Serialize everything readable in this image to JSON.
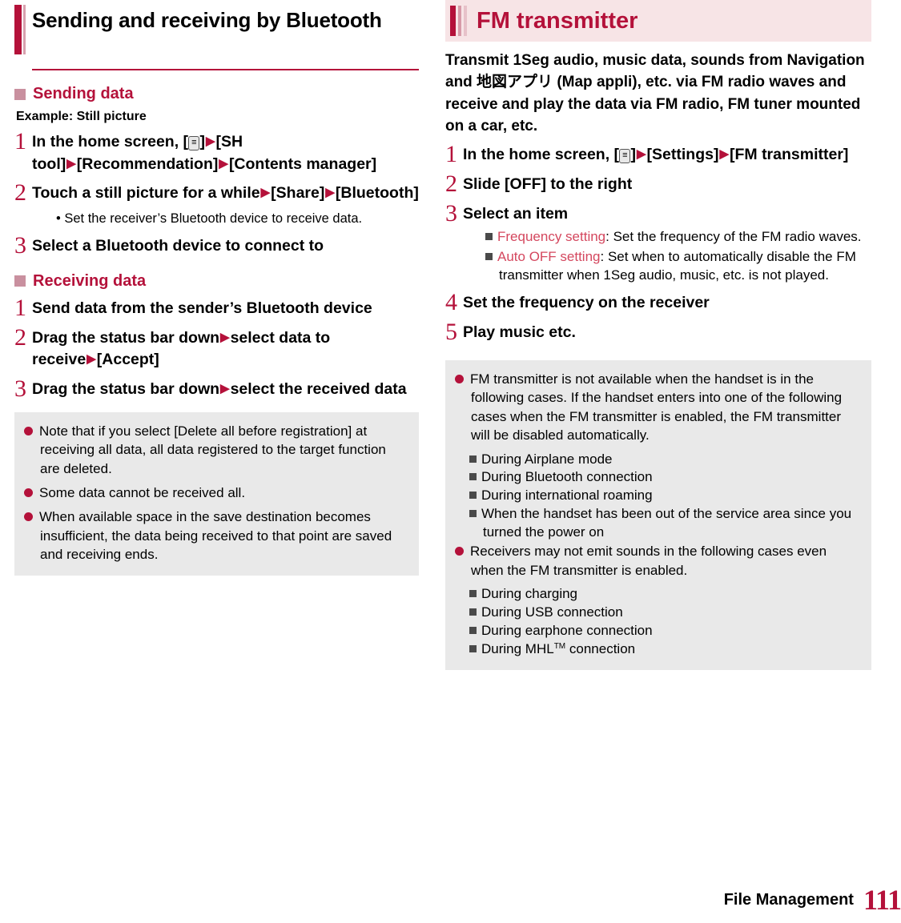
{
  "left": {
    "chapter_title": "Sending and receiving by Bluetooth",
    "section1": {
      "heading": "Sending data",
      "example": "Example: Still picture",
      "steps": [
        {
          "num": "1",
          "parts": [
            {
              "t": "text",
              "v": "In the home screen, ["
            },
            {
              "t": "key",
              "v": "MENU"
            },
            {
              "t": "text",
              "v": "]"
            },
            {
              "t": "arrow"
            },
            {
              "t": "text",
              "v": "[SH tool]"
            },
            {
              "t": "arrow"
            },
            {
              "t": "text",
              "v": "[Recommendation]"
            },
            {
              "t": "arrow"
            },
            {
              "t": "text",
              "v": "[Contents manager]"
            }
          ]
        },
        {
          "num": "2",
          "parts": [
            {
              "t": "text",
              "v": "Touch a still picture for a while"
            },
            {
              "t": "arrow"
            },
            {
              "t": "text",
              "v": "[Share]"
            },
            {
              "t": "arrow"
            },
            {
              "t": "text",
              "v": "[Bluetooth]"
            }
          ],
          "bullets": [
            "Set the receiver’s Bluetooth device to receive data."
          ]
        },
        {
          "num": "3",
          "parts": [
            {
              "t": "text",
              "v": "Select a Bluetooth device to connect to"
            }
          ]
        }
      ]
    },
    "section2": {
      "heading": "Receiving data",
      "steps": [
        {
          "num": "1",
          "parts": [
            {
              "t": "text",
              "v": "Send data from the sender’s Bluetooth device"
            }
          ]
        },
        {
          "num": "2",
          "parts": [
            {
              "t": "text",
              "v": "Drag the status bar down"
            },
            {
              "t": "arrow"
            },
            {
              "t": "text",
              "v": "select data to receive"
            },
            {
              "t": "arrow"
            },
            {
              "t": "text",
              "v": "[Accept]"
            }
          ]
        },
        {
          "num": "3",
          "parts": [
            {
              "t": "text",
              "v": "Drag the status bar down"
            },
            {
              "t": "arrow"
            },
            {
              "t": "text",
              "v": "select the received data"
            }
          ]
        }
      ]
    },
    "notes": [
      {
        "text": "Note that if you select [Delete all before registration] at receiving all data, all data registered to the target function are deleted.",
        "subs": []
      },
      {
        "text": "Some data cannot be received all.",
        "subs": []
      },
      {
        "text": "When available space in the save destination becomes insufficient, the data being received to that point are saved and receiving ends.",
        "subs": []
      }
    ]
  },
  "right": {
    "banner_title": "FM transmitter",
    "intro": "Transmit 1Seg audio, music data, sounds from Navigation and 地図アプリ (Map appli), etc. via FM radio waves and receive and play the data via FM radio, FM tuner mounted on a car, etc.",
    "steps": [
      {
        "num": "1",
        "parts": [
          {
            "t": "text",
            "v": "In the home screen, ["
          },
          {
            "t": "key",
            "v": "MENU"
          },
          {
            "t": "text",
            "v": "]"
          },
          {
            "t": "arrow"
          },
          {
            "t": "text",
            "v": "[Settings]"
          },
          {
            "t": "arrow"
          },
          {
            "t": "text",
            "v": "[FM transmitter]"
          }
        ]
      },
      {
        "num": "2",
        "parts": [
          {
            "t": "text",
            "v": "Slide [OFF] to the right"
          }
        ]
      },
      {
        "num": "3",
        "parts": [
          {
            "t": "text",
            "v": "Select an item"
          }
        ],
        "subitems": [
          {
            "term": "Frequency setting",
            "rest": ": Set the frequency of the FM radio waves."
          },
          {
            "term": "Auto OFF setting",
            "rest": ": Set when to automatically disable the FM transmitter when 1Seg audio, music, etc. is not played."
          }
        ]
      },
      {
        "num": "4",
        "parts": [
          {
            "t": "text",
            "v": "Set the frequency on the receiver"
          }
        ]
      },
      {
        "num": "5",
        "parts": [
          {
            "t": "text",
            "v": "Play music etc."
          }
        ]
      }
    ],
    "notes": [
      {
        "text": "FM transmitter is not available when the handset is in the following cases. If the handset enters into one of the following cases when the FM transmitter is enabled, the FM transmitter will be disabled automatically.",
        "subs": [
          "During Airplane mode",
          "During Bluetooth connection",
          "During international roaming",
          "When the handset has been out of the service area since you turned the power on"
        ]
      },
      {
        "text": "Receivers may not emit sounds in the following cases even when the FM transmitter is enabled.",
        "subs": [
          "During charging",
          "During USB connection",
          "During earphone connection",
          "During MHL™ connection"
        ]
      }
    ]
  },
  "footer": {
    "label": "File Management",
    "page": "111"
  },
  "colors": {
    "accent": "#b4113a",
    "banner_bg": "#f7e4e6",
    "note_bg": "#e9e9e9",
    "red_term": "#d4475e"
  }
}
